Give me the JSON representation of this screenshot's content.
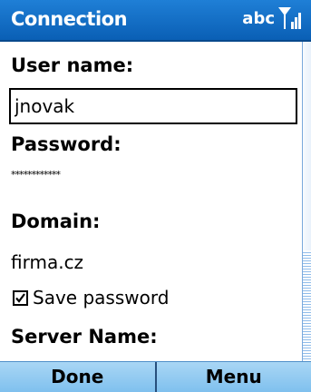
{
  "titlebar": {
    "title": "Connection",
    "input_mode": "abc",
    "signal_icon": "signal-strength-icon"
  },
  "form": {
    "user_name_label": "User name:",
    "user_name_value": "jnovak",
    "password_label": "Password:",
    "password_value": "************",
    "domain_label": "Domain:",
    "domain_value": "firma.cz",
    "save_password_label": "Save password",
    "save_password_checked": true,
    "server_name_label": "Server Name:"
  },
  "softkeys": {
    "left": "Done",
    "right": "Menu"
  },
  "colors": {
    "titlebar": "#0a5fb5",
    "softkeys": "#8fc8f0",
    "scroll_thumb": "#8fbcea"
  }
}
